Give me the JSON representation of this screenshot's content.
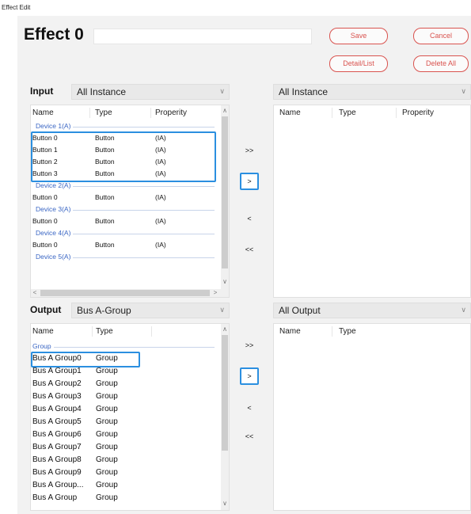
{
  "window": {
    "title": "Effect Edit"
  },
  "effect": {
    "name": "Effect 0"
  },
  "buttons": {
    "save": "Save",
    "cancel": "Cancel",
    "detail_list": "Detail/List",
    "delete_all": "Delete All"
  },
  "colors": {
    "accent_red": "#d9534f",
    "highlight_blue": "#2b8fe0",
    "group_blue": "#3a66c4"
  },
  "input": {
    "label": "Input",
    "filter": "All Instance",
    "columns": [
      "Name",
      "Type",
      "Properity"
    ],
    "groups": [
      {
        "label": "Device 1(A)",
        "rows": [
          {
            "name": "Button 0",
            "type": "Button",
            "prop": "(IA)"
          },
          {
            "name": "Button 1",
            "type": "Button",
            "prop": "(IA)"
          },
          {
            "name": "Button 2",
            "type": "Button",
            "prop": "(IA)"
          },
          {
            "name": "Button 3",
            "type": "Button",
            "prop": "(IA)"
          }
        ]
      },
      {
        "label": "Device 2(A)",
        "rows": [
          {
            "name": "Button 0",
            "type": "Button",
            "prop": "(IA)"
          }
        ]
      },
      {
        "label": "Device 3(A)",
        "rows": [
          {
            "name": "Button 0",
            "type": "Button",
            "prop": "(IA)"
          }
        ]
      },
      {
        "label": "Device 4(A)",
        "rows": [
          {
            "name": "Button 0",
            "type": "Button",
            "prop": "(IA)"
          }
        ]
      },
      {
        "label": "Device 5(A)",
        "rows": []
      }
    ]
  },
  "selected_input": {
    "filter": "All Instance",
    "columns": [
      "Name",
      "Type",
      "Properity"
    ]
  },
  "output": {
    "label": "Output",
    "filter": "Bus A-Group",
    "columns": [
      "Name",
      "Type"
    ],
    "group_label": "Group",
    "rows": [
      {
        "name": "Bus A Group0",
        "type": "Group"
      },
      {
        "name": "Bus A Group1",
        "type": "Group"
      },
      {
        "name": "Bus A Group2",
        "type": "Group"
      },
      {
        "name": "Bus A Group3",
        "type": "Group"
      },
      {
        "name": "Bus A Group4",
        "type": "Group"
      },
      {
        "name": "Bus A Group5",
        "type": "Group"
      },
      {
        "name": "Bus A Group6",
        "type": "Group"
      },
      {
        "name": "Bus A Group7",
        "type": "Group"
      },
      {
        "name": "Bus A Group8",
        "type": "Group"
      },
      {
        "name": "Bus A Group9",
        "type": "Group"
      },
      {
        "name": "Bus A Group...",
        "type": "Group"
      },
      {
        "name": "Bus A Group",
        "type": "Group"
      }
    ]
  },
  "selected_output": {
    "filter": "All Output",
    "columns": [
      "Name",
      "Type"
    ]
  },
  "move": {
    "add_all": ">>",
    "add": ">",
    "remove": "<",
    "remove_all": "<<"
  }
}
